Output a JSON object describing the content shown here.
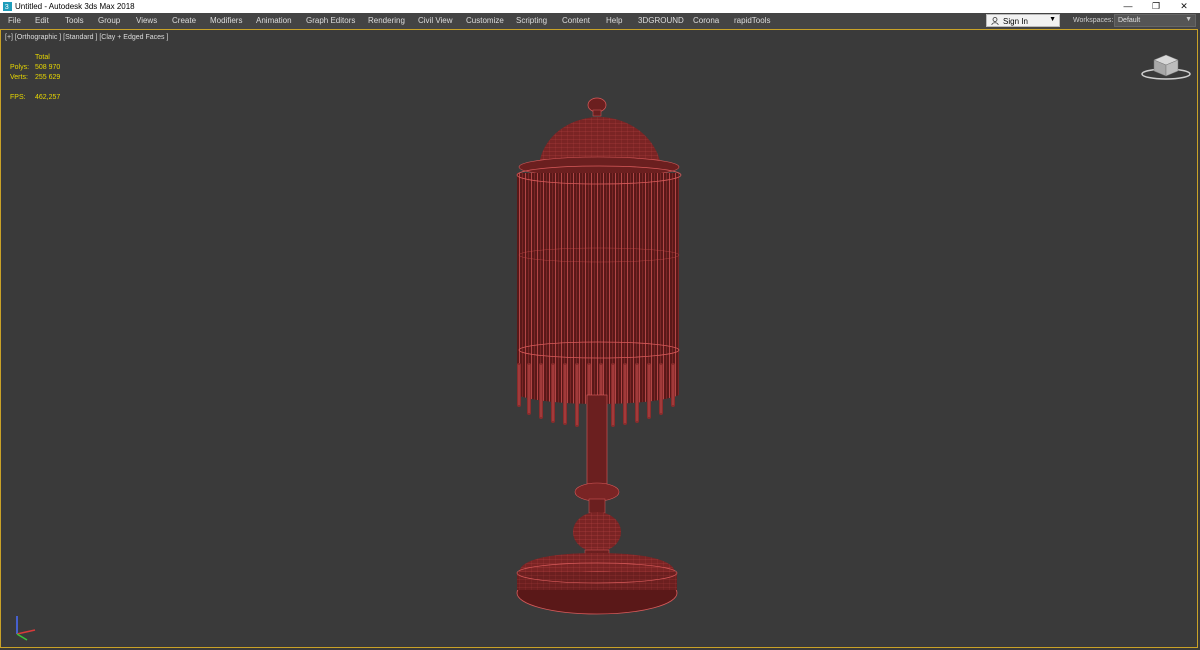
{
  "window": {
    "title": "Untitled - Autodesk 3ds Max 2018",
    "controls": {
      "minimize": "—",
      "restore": "❐",
      "close": "✕"
    }
  },
  "menubar": {
    "items": [
      "File",
      "Edit",
      "Tools",
      "Group",
      "Views",
      "Create",
      "Modifiers",
      "Animation",
      "Graph Editors",
      "Rendering",
      "Civil View",
      "Customize",
      "Scripting",
      "Content",
      "Help",
      "3DGROUND",
      "Corona",
      "rapidTools"
    ],
    "signin_label": "Sign In",
    "workspaces_label": "Workspaces:",
    "workspaces_value": "Default"
  },
  "viewport": {
    "label": "[+] [Orthographic ] [Standard ] [Clay + Edged Faces ]",
    "stats": {
      "header": "Total",
      "polys_label": "Polys:",
      "polys_value": "508 970",
      "verts_label": "Verts:",
      "verts_value": "255 629",
      "fps_label": "FPS:",
      "fps_value": "462,257"
    },
    "icons": {
      "viewcube": "viewcube-icon",
      "axis": "axis-gizmo-icon"
    }
  },
  "colors": {
    "viewport_bg": "#3a3a3a",
    "viewport_border": "#c9a227",
    "stats_text": "#e8d800",
    "model_fill": "#6b1f1f",
    "model_wire": "#d85a5a"
  }
}
